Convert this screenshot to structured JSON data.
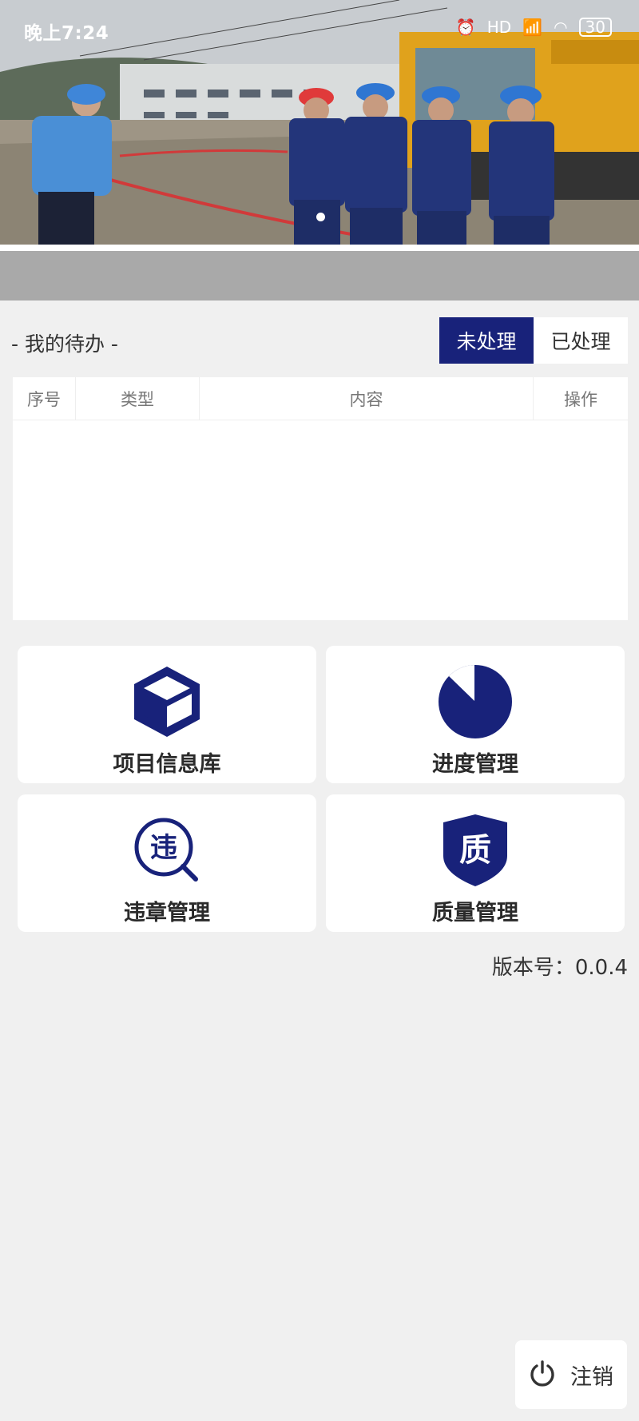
{
  "status_bar": {
    "time": "晚上7:24",
    "battery": "30"
  },
  "banner": {
    "slide_count": 1,
    "active_slide": 1
  },
  "todo": {
    "title": "- 我的待办 -",
    "tabs": [
      {
        "label": "未处理",
        "active": true
      },
      {
        "label": "已处理",
        "active": false
      }
    ],
    "columns": [
      "序号",
      "类型",
      "内容",
      "操作"
    ],
    "rows": []
  },
  "features": [
    {
      "label": "项目信息库",
      "icon": "cube-icon"
    },
    {
      "label": "进度管理",
      "icon": "progress-pie-icon"
    },
    {
      "label": "违章管理",
      "icon": "violation-search-icon",
      "icon_text": "违"
    },
    {
      "label": "质量管理",
      "icon": "quality-shield-icon",
      "icon_text": "质"
    }
  ],
  "version": "版本号：0.0.4",
  "logout": {
    "label": "注销",
    "icon": "power-icon"
  },
  "colors": {
    "accent": "#18227a",
    "background": "#f0f0f0",
    "strip": "#a9a9a9"
  }
}
